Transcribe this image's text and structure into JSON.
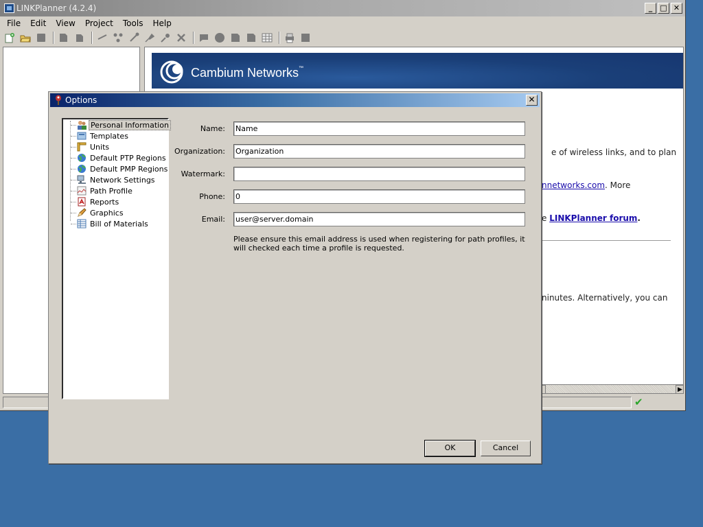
{
  "main_window": {
    "title": "LINKPlanner (4.2.4)",
    "buttons": {
      "minimize": "_",
      "maximize": "□",
      "close": "✕"
    },
    "menu": [
      "File",
      "Edit",
      "View",
      "Project",
      "Tools",
      "Help"
    ],
    "toolbar_icons": [
      "new-project-icon",
      "open-project-icon",
      "save-icon",
      "copy-icon",
      "paste-icon",
      "link-icon",
      "network-icon",
      "add-link-icon",
      "pmp-icon",
      "ptp-icon",
      "delete-icon",
      "comment-icon",
      "site-icon",
      "report-icon",
      "export-icon",
      "table-icon",
      "print-icon",
      "stop-icon"
    ],
    "banner": {
      "brand": "Cambium Networks",
      "trademark": "™"
    },
    "content_fragments": {
      "line1": "e of wireless links, and to plan",
      "line2_link": "nnetworks.com",
      "line2_rest": ". More",
      "line3_prefix": "e ",
      "line3_link": "LINKPlanner forum",
      "line3_rest": ".",
      "line4": "ninutes. Alternatively, you can"
    },
    "status_icon": "check-icon"
  },
  "options_dialog": {
    "title": "Options",
    "close_label": "✕",
    "tree": [
      {
        "label": "Personal Information",
        "icon": "user-icon",
        "selected": true
      },
      {
        "label": "Templates",
        "icon": "template-icon"
      },
      {
        "label": "Units",
        "icon": "ruler-icon"
      },
      {
        "label": "Default PTP Regions",
        "icon": "globe-icon"
      },
      {
        "label": "Default PMP Regions",
        "icon": "globe-icon"
      },
      {
        "label": "Network Settings",
        "icon": "network-icon"
      },
      {
        "label": "Path Profile",
        "icon": "profile-icon"
      },
      {
        "label": "Reports",
        "icon": "pdf-icon"
      },
      {
        "label": "Graphics",
        "icon": "pencil-icon"
      },
      {
        "label": "Bill of Materials",
        "icon": "table-icon"
      }
    ],
    "fields": {
      "name": {
        "label": "Name:",
        "value": "Name"
      },
      "organization": {
        "label": "Organization:",
        "value": "Organization"
      },
      "watermark": {
        "label": "Watermark:",
        "value": ""
      },
      "phone": {
        "label": "Phone:",
        "value": "0"
      },
      "email": {
        "label": "Email:",
        "value": "user@server.domain"
      }
    },
    "note": "Please ensure this email address is used when registering for path profiles, it will checked each time a profile is requested.",
    "buttons": {
      "ok": "OK",
      "cancel": "Cancel"
    }
  }
}
